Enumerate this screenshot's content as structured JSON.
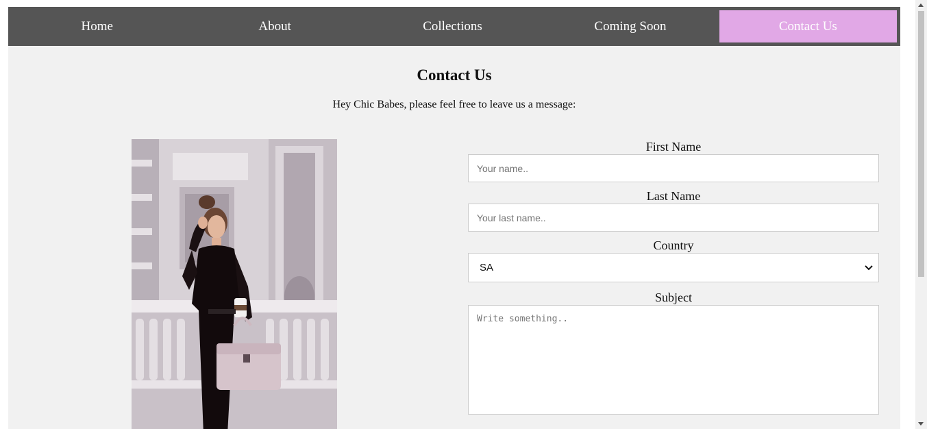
{
  "nav": {
    "items": [
      {
        "label": "Home"
      },
      {
        "label": "About"
      },
      {
        "label": "Collections"
      },
      {
        "label": "Coming Soon"
      },
      {
        "label": "Contact Us"
      }
    ],
    "active_color": "#e1a8e6",
    "bar_color": "#555555"
  },
  "main": {
    "title": "Contact Us",
    "subtitle": "Hey Chic Babes, please feel free to leave us a message:"
  },
  "image": {
    "icon": "woman-with-handbag-photo"
  },
  "form": {
    "first_name": {
      "label": "First Name",
      "placeholder": "Your name.."
    },
    "last_name": {
      "label": "Last Name",
      "placeholder": "Your last name.."
    },
    "country": {
      "label": "Country",
      "selected": "SA"
    },
    "subject": {
      "label": "Subject",
      "placeholder": "Write something.."
    }
  }
}
